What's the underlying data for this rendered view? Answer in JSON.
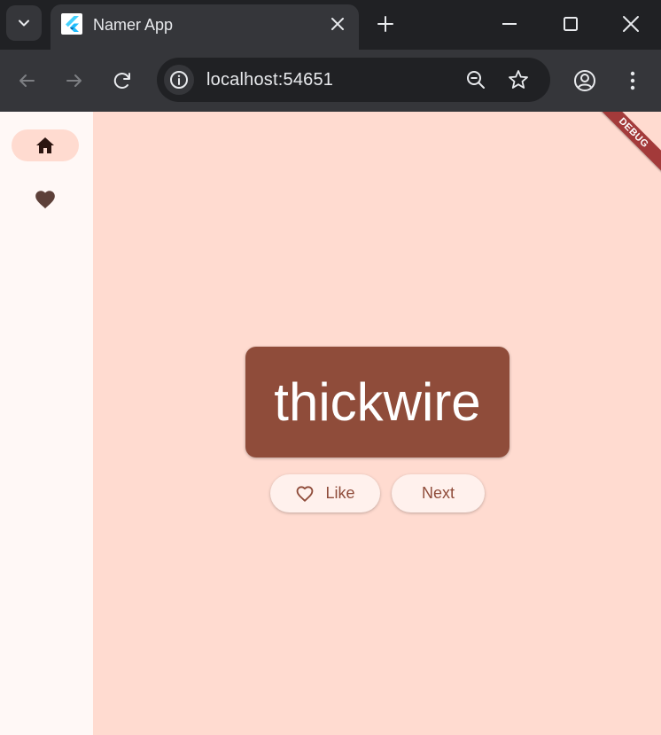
{
  "browser": {
    "tab": {
      "title": "Namer App"
    },
    "address_bar": {
      "host": "localhost",
      "port": ":54651"
    }
  },
  "app": {
    "debug_banner": "DEBUG",
    "rail": {
      "destinations": [
        {
          "icon": "home-icon",
          "selected": true
        },
        {
          "icon": "favorite-icon",
          "selected": false
        }
      ]
    },
    "word_pair": "thickwire",
    "like_button": {
      "label": "Like",
      "icon": "heart-outline-icon"
    },
    "next_button": {
      "label": "Next"
    }
  },
  "colors": {
    "app_background": "#ffdbd0",
    "rail_background": "#fff8f6",
    "card_primary": "#8f4c3a",
    "button_background": "#fff1ed",
    "debug_banner": "#a33a3a"
  }
}
